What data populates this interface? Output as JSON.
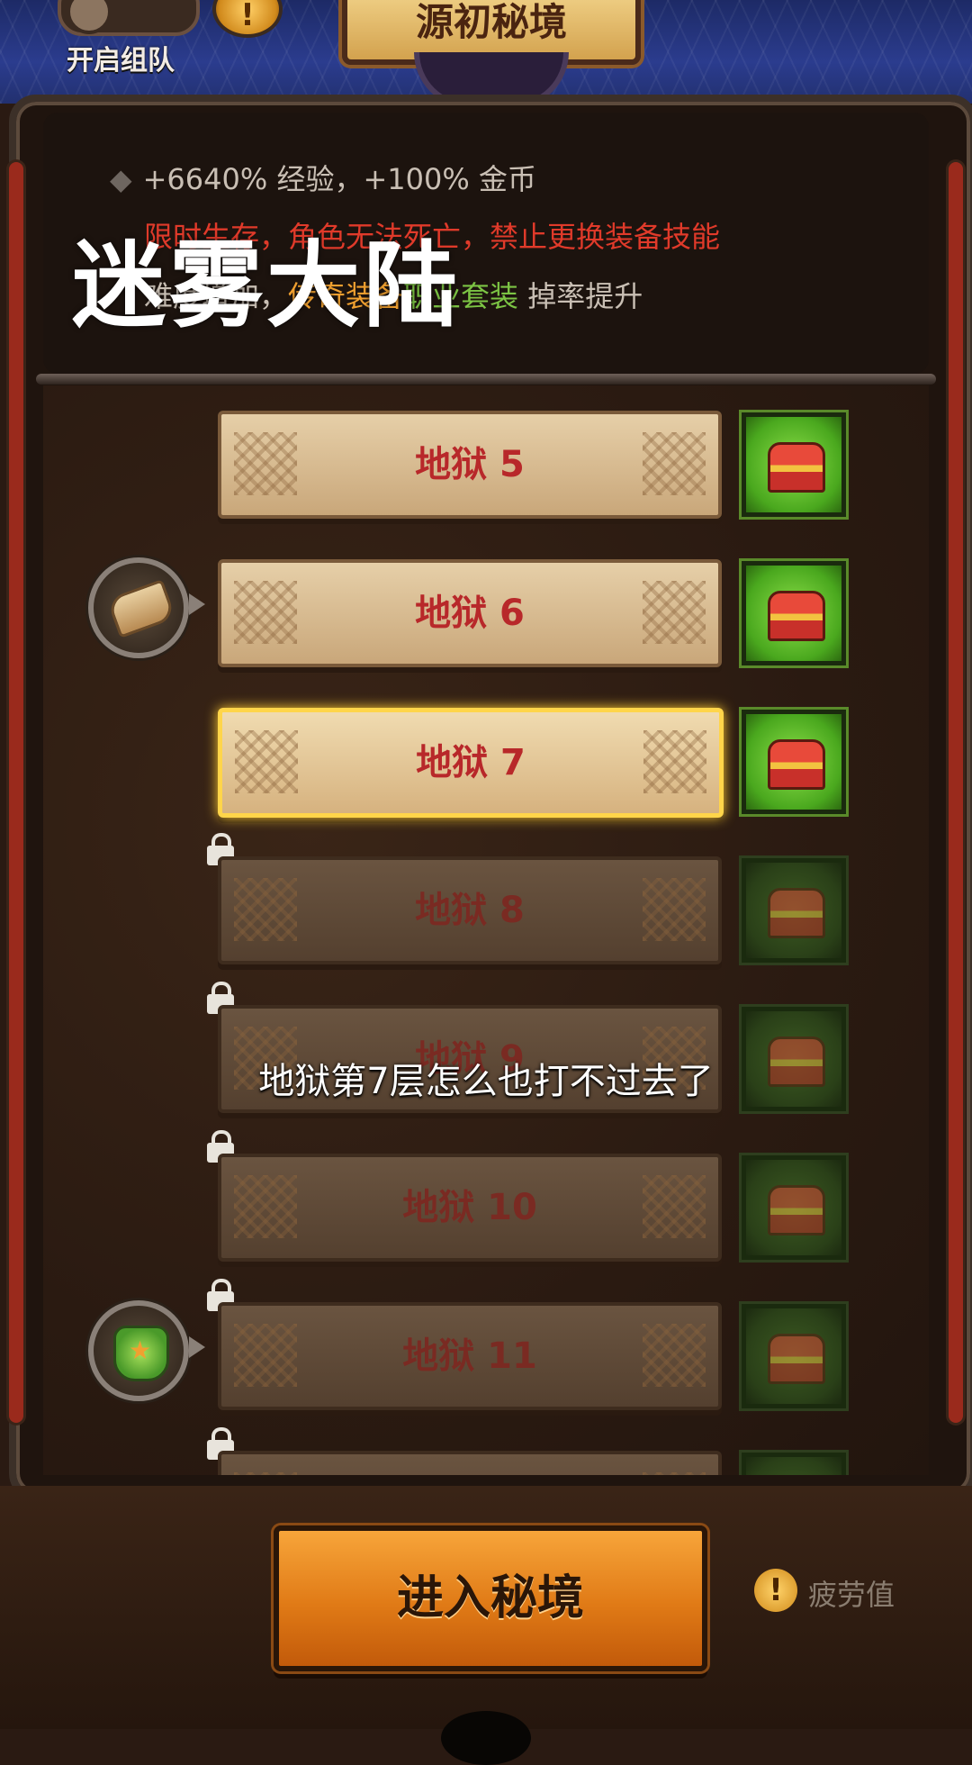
{
  "header": {
    "team_label": "开启组队",
    "title": "源初秘境",
    "info_icon_glyph": "!"
  },
  "overlay_title": "迷雾大陆",
  "info": {
    "bullet_glyph": "◆",
    "line1": "+6640% 经验，+100% 金币",
    "line2": "限时生存，角色无法死亡，禁止更换装备技能",
    "line3_prefix": "难度增加，",
    "line3_orange": "传奇装备",
    "line3_green": "职业套装",
    "line3_suffix": " 掉率提升"
  },
  "levels": [
    {
      "label": "地狱 5",
      "state": "unlocked"
    },
    {
      "label": "地狱 6",
      "state": "unlocked",
      "reward": "scroll-icon"
    },
    {
      "label": "地狱 7",
      "state": "selected"
    },
    {
      "label": "地狱 8",
      "state": "locked"
    },
    {
      "label": "地狱 9",
      "state": "locked"
    },
    {
      "label": "地狱 10",
      "state": "locked"
    },
    {
      "label": "地狱 11",
      "state": "locked",
      "reward": "armor-icon"
    },
    {
      "label": "",
      "state": "locked"
    }
  ],
  "subtitle": "地狱第7层怎么也打不过去了",
  "footer": {
    "enter_button": "进入秘境",
    "fatigue_label": "疲劳值",
    "fatigue_icon_glyph": "!"
  },
  "colors": {
    "accent_green": "#7cc444",
    "accent_red": "#e03a2a",
    "accent_orange": "#f0a030",
    "selected_border": "#ffd54a"
  }
}
